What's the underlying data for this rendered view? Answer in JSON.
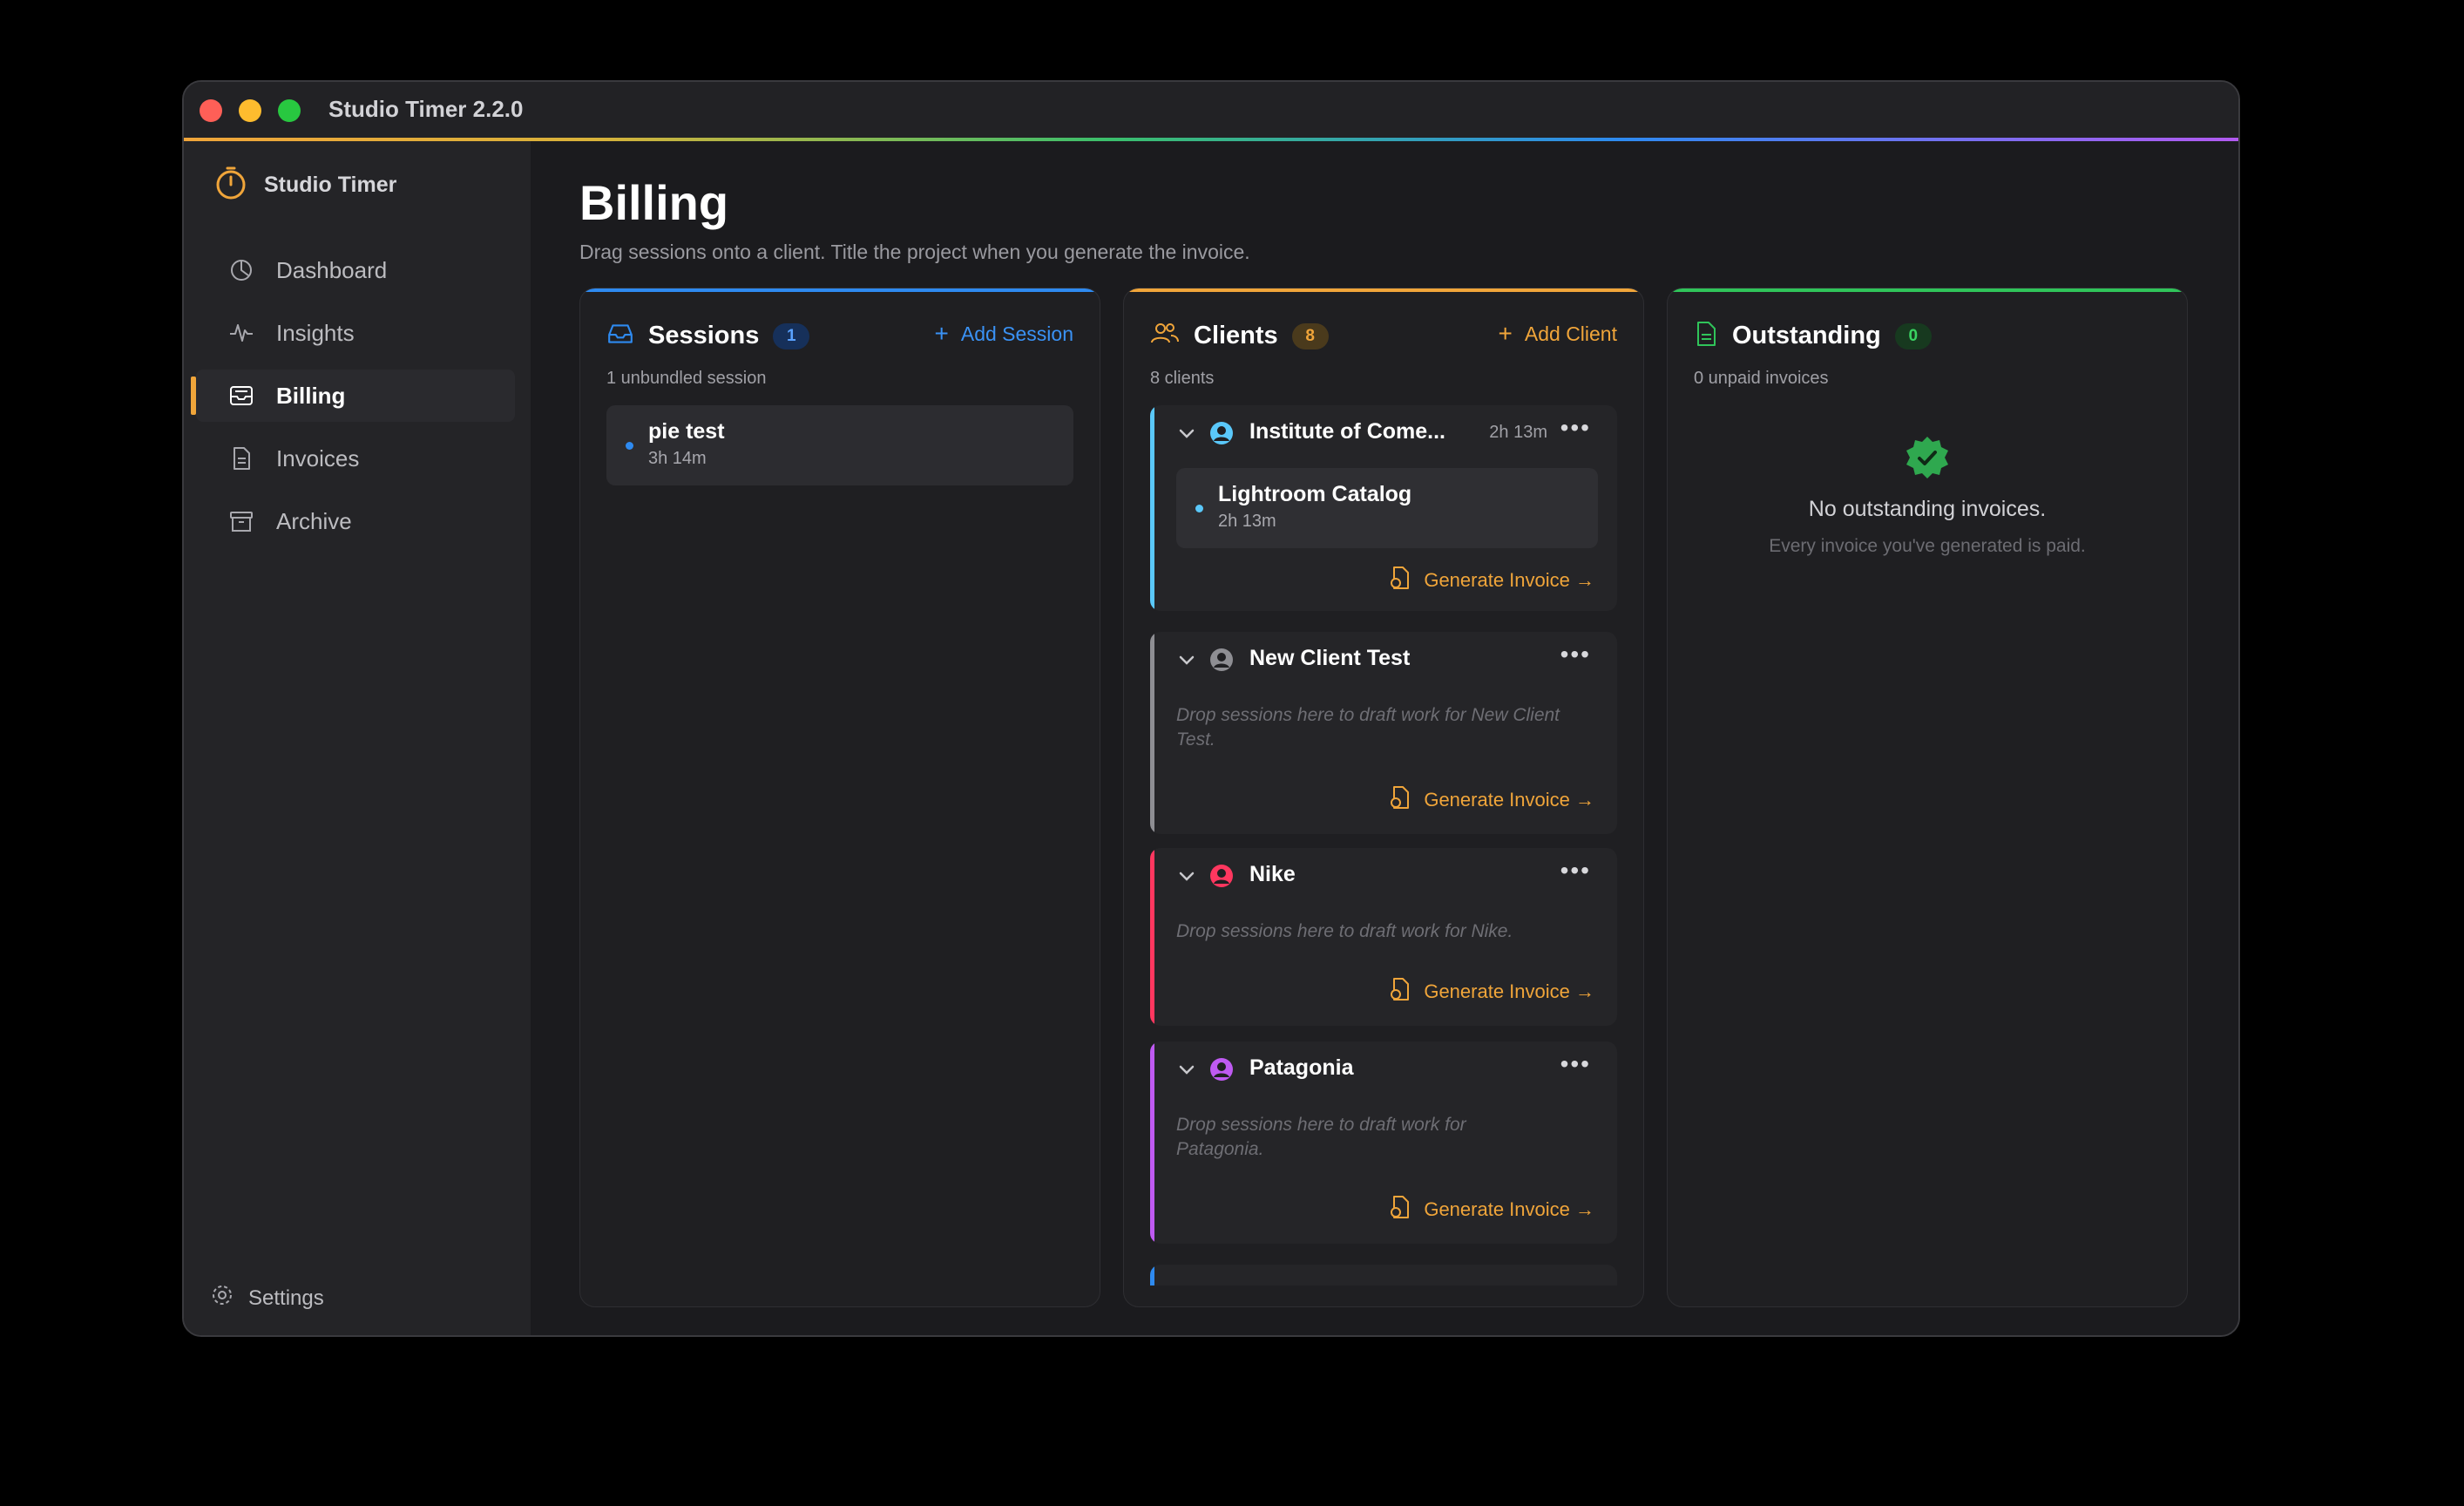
{
  "window": {
    "title": "Studio Timer 2.2.0"
  },
  "sidebar": {
    "brand": "Studio Timer",
    "items": [
      {
        "label": "Dashboard",
        "icon": "clock-pie-icon"
      },
      {
        "label": "Insights",
        "icon": "activity-icon"
      },
      {
        "label": "Billing",
        "icon": "inbox-icon",
        "active": true
      },
      {
        "label": "Invoices",
        "icon": "document-icon"
      },
      {
        "label": "Archive",
        "icon": "archive-box-icon"
      }
    ],
    "settings": "Settings"
  },
  "page": {
    "title": "Billing",
    "subtitle": "Drag sessions onto a client. Title the project when you generate the invoice."
  },
  "sessions": {
    "title": "Sessions",
    "badge": "1",
    "action": "Add Session",
    "count_text": "1 unbundled session",
    "items": [
      {
        "name": "pie test",
        "duration": "3h 14m"
      }
    ],
    "accent": "#2e8af0"
  },
  "clients": {
    "title": "Clients",
    "badge": "8",
    "action": "Add Client",
    "count_text": "8 clients",
    "accent": "#f0a53a",
    "generate_label": "Generate Invoice →",
    "items": [
      {
        "name": "Institute of Come...",
        "time": "2h 13m",
        "color": "#5ac8fa",
        "session": {
          "name": "Lightroom Catalog",
          "duration": "2h 13m"
        }
      },
      {
        "name": "New Client Test",
        "color": "#8e8e93",
        "drop_text": "Drop sessions here to draft work for New Client Test."
      },
      {
        "name": "Nike",
        "color": "#ff375f",
        "drop_text": "Drop sessions here to draft work for Nike."
      },
      {
        "name": "Patagonia",
        "color": "#bf5af2",
        "drop_text": "Drop sessions here to draft work for Patagonia."
      }
    ]
  },
  "outstanding": {
    "title": "Outstanding",
    "badge": "0",
    "count_text": "0 unpaid invoices",
    "accent": "#30c45a",
    "empty_title": "No outstanding invoices.",
    "empty_sub": "Every invoice you've generated is paid."
  }
}
